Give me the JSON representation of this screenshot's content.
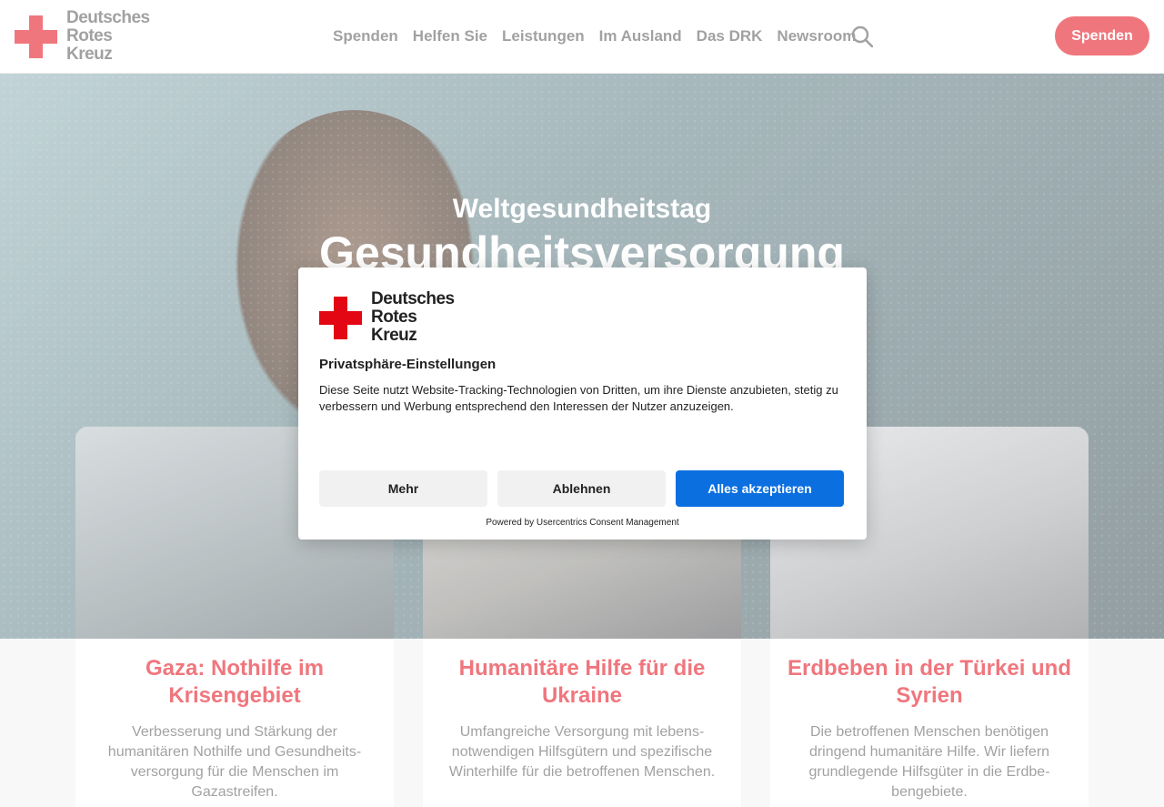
{
  "header": {
    "logo_lines": [
      "Deutsches",
      "Rotes",
      "Kreuz"
    ],
    "nav": [
      "Spenden",
      "Helfen Sie",
      "Leistungen",
      "Im Ausland",
      "Das DRK",
      "Newsroom"
    ],
    "donate_label": "Spenden"
  },
  "hero": {
    "kicker": "Weltgesundheitstag",
    "title": "Gesundheitsversorgung"
  },
  "cards": [
    {
      "title": "Gaza: Nothilfe im Krisengebiet",
      "text": "Verbesserung und Stärkung der humanitären Nothilfe und Gesundheits-versorgung für die Menschen im Gazastreifen."
    },
    {
      "title": "Humanitäre Hilfe für die Ukraine",
      "text": "Umfangreiche Versorgung mit lebens-notwendigen Hilfsgütern und spezifische Winterhilfe für die betroffenen Menschen."
    },
    {
      "title": "Erdbeben in der Türkei und Syrien",
      "text": "Die betroffenen Menschen benötigen dringend humanitäre Hilfe. Wir liefern grundlegende Hilfsgüter in die Erdbe-bengebiete."
    }
  ],
  "consent": {
    "logo_lines": [
      "Deutsches",
      "Rotes",
      "Kreuz"
    ],
    "title": "Privatsphäre-Einstellungen",
    "text": "Diese Seite nutzt Website-Tracking-Technologien von Dritten, um ihre Dienste anzubieten, stetig zu verbessern und Werbung entsprechend den Interessen der Nutzer anzuzeigen.",
    "more_label": "Mehr",
    "deny_label": "Ablehnen",
    "accept_label": "Alles akzeptieren",
    "powered": "Powered by Usercentrics Consent Management"
  },
  "colors": {
    "brand_red": "#e30613",
    "accept_blue": "#0b6fe0"
  }
}
